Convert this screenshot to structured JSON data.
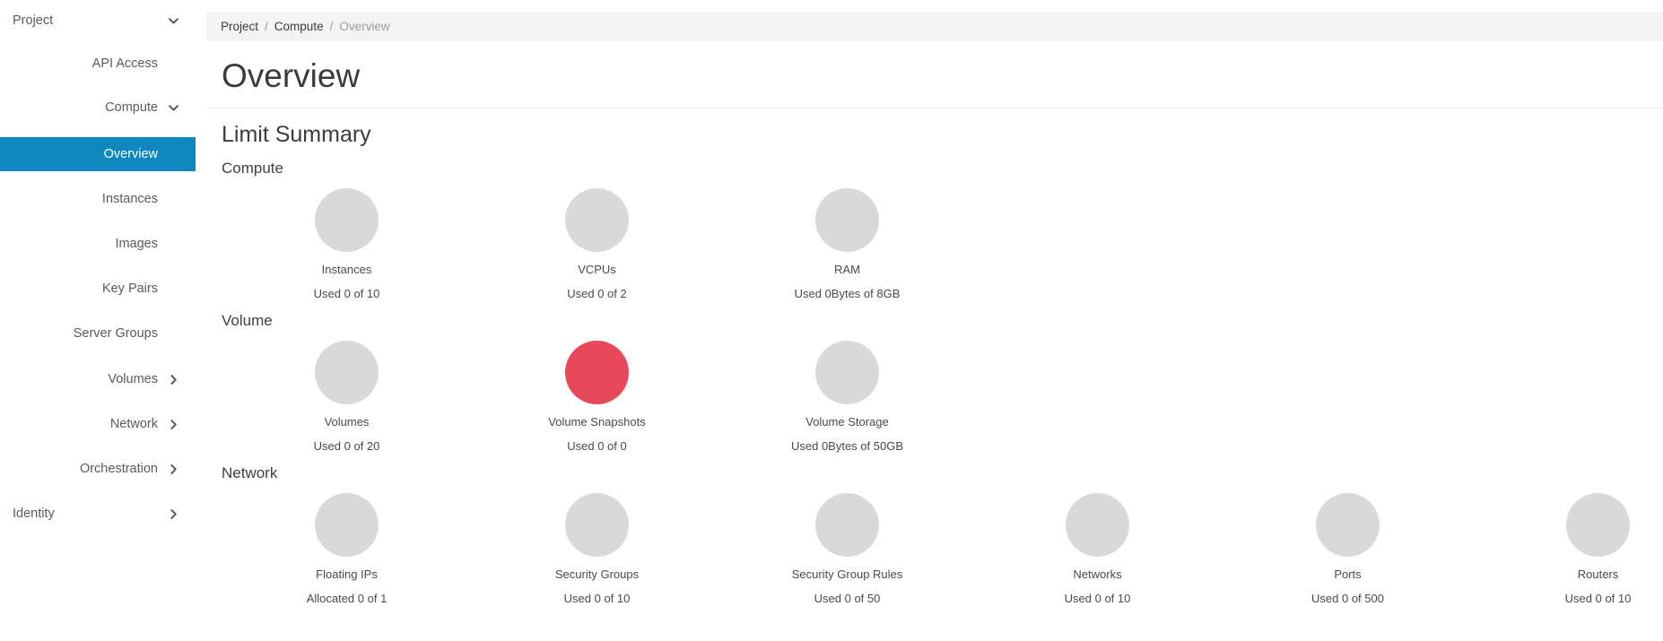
{
  "sidebar": {
    "items": [
      {
        "label": "Project",
        "level": 0,
        "icon": "chevron-down-icon",
        "active": false,
        "cls": "r-project"
      },
      {
        "label": "API Access",
        "level": 2,
        "icon": "none",
        "active": false,
        "cls": "r-api"
      },
      {
        "label": "Compute",
        "level": 1,
        "icon": "chevron-down-icon",
        "active": false,
        "cls": "r-compute"
      },
      {
        "label": "Overview",
        "level": 2,
        "icon": "none",
        "active": true,
        "cls": "r-overview"
      },
      {
        "label": "Instances",
        "level": 2,
        "icon": "none",
        "active": false,
        "cls": "r-instances"
      },
      {
        "label": "Images",
        "level": 2,
        "icon": "none",
        "active": false,
        "cls": "r-images"
      },
      {
        "label": "Key Pairs",
        "level": 2,
        "icon": "none",
        "active": false,
        "cls": "r-keypairs"
      },
      {
        "label": "Server Groups",
        "level": 2,
        "icon": "none",
        "active": false,
        "cls": "r-servergrp"
      },
      {
        "label": "Volumes",
        "level": 1,
        "icon": "chevron-right-icon",
        "active": false,
        "cls": "r-volumes"
      },
      {
        "label": "Network",
        "level": 1,
        "icon": "chevron-right-icon",
        "active": false,
        "cls": "r-network"
      },
      {
        "label": "Orchestration",
        "level": 1,
        "icon": "chevron-right-icon",
        "active": false,
        "cls": "r-orch"
      },
      {
        "label": "Identity",
        "level": 0,
        "icon": "chevron-right-icon",
        "active": false,
        "cls": "r-identity"
      }
    ]
  },
  "breadcrumb": {
    "items": [
      {
        "label": "Project",
        "current": false
      },
      {
        "label": "Compute",
        "current": false
      },
      {
        "label": "Overview",
        "current": true
      }
    ],
    "separator": "/"
  },
  "page": {
    "title": "Overview",
    "limit_summary_heading": "Limit Summary"
  },
  "colors": {
    "accent_blue": "#0f86bd",
    "quota_empty_gray": "#d9d9d9",
    "quota_full_red": "#e8495a",
    "breadcrumb_bg": "#f4f4f4"
  },
  "sections": [
    {
      "title": "Compute",
      "items": [
        {
          "label": "Instances",
          "usage": "Used 0 of 10",
          "used": 0,
          "quota": 10,
          "full": false
        },
        {
          "label": "VCPUs",
          "usage": "Used 0 of 2",
          "used": 0,
          "quota": 2,
          "full": false
        },
        {
          "label": "RAM",
          "usage": "Used 0Bytes of 8GB",
          "used": 0,
          "quota": 8,
          "full": false
        }
      ]
    },
    {
      "title": "Volume",
      "items": [
        {
          "label": "Volumes",
          "usage": "Used 0 of 20",
          "used": 0,
          "quota": 20,
          "full": false
        },
        {
          "label": "Volume Snapshots",
          "usage": "Used 0 of 0",
          "used": 0,
          "quota": 0,
          "full": true
        },
        {
          "label": "Volume Storage",
          "usage": "Used 0Bytes of 50GB",
          "used": 0,
          "quota": 50,
          "full": false
        }
      ]
    },
    {
      "title": "Network",
      "items": [
        {
          "label": "Floating IPs",
          "usage": "Allocated 0 of 1",
          "used": 0,
          "quota": 1,
          "full": false
        },
        {
          "label": "Security Groups",
          "usage": "Used 0 of 10",
          "used": 0,
          "quota": 10,
          "full": false
        },
        {
          "label": "Security Group Rules",
          "usage": "Used 0 of 50",
          "used": 0,
          "quota": 50,
          "full": false
        },
        {
          "label": "Networks",
          "usage": "Used 0 of 10",
          "used": 0,
          "quota": 10,
          "full": false
        },
        {
          "label": "Ports",
          "usage": "Used 0 of 500",
          "used": 0,
          "quota": 500,
          "full": false
        },
        {
          "label": "Routers",
          "usage": "Used 0 of 10",
          "used": 0,
          "quota": 10,
          "full": false
        }
      ]
    }
  ],
  "chart_data": {
    "type": "pie",
    "title": "Limit Summary",
    "groups": [
      {
        "name": "Compute",
        "categories": [
          "Instances",
          "VCPUs",
          "RAM"
        ],
        "used": [
          0,
          0,
          0
        ],
        "quota": [
          10,
          2,
          8
        ],
        "percent_used": [
          0,
          0,
          0
        ],
        "labels": [
          "Used 0 of 10",
          "Used 0 of 2",
          "Used 0Bytes of 8GB"
        ]
      },
      {
        "name": "Volume",
        "categories": [
          "Volumes",
          "Volume Snapshots",
          "Volume Storage"
        ],
        "used": [
          0,
          0,
          0
        ],
        "quota": [
          20,
          0,
          50
        ],
        "percent_used": [
          0,
          100,
          0
        ],
        "labels": [
          "Used 0 of 20",
          "Used 0 of 0",
          "Used 0Bytes of 50GB"
        ]
      },
      {
        "name": "Network",
        "categories": [
          "Floating IPs",
          "Security Groups",
          "Security Group Rules",
          "Networks",
          "Ports",
          "Routers"
        ],
        "used": [
          0,
          0,
          0,
          0,
          0,
          0
        ],
        "quota": [
          1,
          10,
          50,
          10,
          500,
          10
        ],
        "percent_used": [
          0,
          0,
          0,
          0,
          0,
          0
        ],
        "labels": [
          "Allocated 0 of 1",
          "Used 0 of 10",
          "Used 0 of 50",
          "Used 0 of 10",
          "Used 0 of 500",
          "Used 0 of 10"
        ]
      }
    ]
  }
}
